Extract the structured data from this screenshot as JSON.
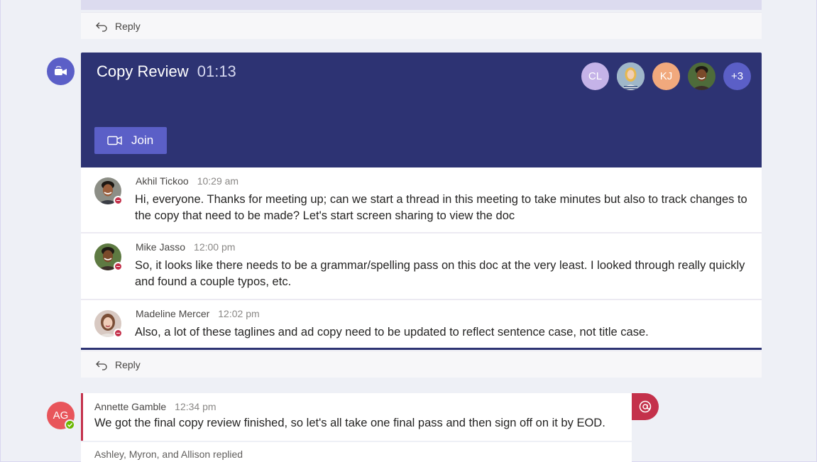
{
  "reply_label": "Reply",
  "meeting": {
    "title": "Copy Review",
    "duration": "01:13",
    "join_label": "Join",
    "participants": [
      {
        "initials": "CL",
        "color": "#c5b3e8"
      },
      {
        "initials": "",
        "color": "#9fb7c9"
      },
      {
        "initials": "KJ",
        "color": "#f1a97d"
      },
      {
        "initials": "",
        "color": "#4e6b3a"
      }
    ],
    "overflow": "+3"
  },
  "messages": [
    {
      "author": "Akhil Tickoo",
      "time": "10:29 am",
      "text": "Hi, everyone. Thanks for meeting up; can we start a thread in this meeting to take minutes but also to track changes to the copy that need to be made? Let's start screen sharing to view the doc"
    },
    {
      "author": "Mike Jasso",
      "time": "12:00 pm",
      "text": "So, it looks like there needs to be a grammar/spelling pass on this doc at the very least. I looked through really quickly and found a couple typos, etc."
    },
    {
      "author": "Madeline Mercer",
      "time": "12:02 pm",
      "text": "Also, a lot of these taglines and ad copy need to be updated to reflect sentence case, not title case."
    }
  ],
  "post": {
    "avatar_initials": "AG",
    "author": "Annette Gamble",
    "time": "12:34 pm",
    "text": "We got the final copy review finished, so let's all take one final pass and then sign off on it by EOD.",
    "replies_summary": "Ashley, Myron, and Allison replied",
    "mention_symbol": "@"
  },
  "colors": {
    "meeting_bg": "#2d3373",
    "accent": "#5b5fc7",
    "important": "#c4314b",
    "available": "#6bb700"
  }
}
